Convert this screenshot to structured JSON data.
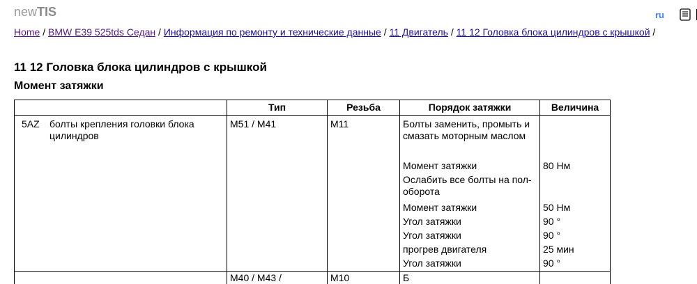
{
  "header": {
    "logo_prefix": "new",
    "logo_bold": "TIS",
    "lang": "ru"
  },
  "breadcrumb": {
    "items": [
      "Home",
      "BMW E39 525tds Седан",
      "Информация по ремонту и технические данные",
      "11 Двигатель",
      "11 12 Головка блока цилиндров с крышкой"
    ],
    "separator": " / "
  },
  "page": {
    "title": "11 12 Головка блока цилиндров с крышкой",
    "section": "Момент затяжки"
  },
  "table": {
    "headers": [
      "",
      "Тип",
      "Резьба",
      "Порядок затяжки",
      "Величина"
    ],
    "row": {
      "code": "5AZ",
      "description": "болты крепления головки блока цилиндров",
      "type": "M51 / M41",
      "thread": "M11",
      "steps": [
        {
          "step": "Болты заменить, промыть и смазать моторным маслом",
          "value": ""
        },
        {
          "step": "Момент затяжки",
          "value": "80 Нм"
        },
        {
          "step": "Ослабить все болты на пол-оборота",
          "value": ""
        },
        {
          "step": "Момент затяжки",
          "value": "50 Нм"
        },
        {
          "step": "Угол затяжки",
          "value": "90 °"
        },
        {
          "step": "Угол затяжки",
          "value": "90 °"
        },
        {
          "step": "прогрев двигателя",
          "value": "25 мин"
        },
        {
          "step": "Угол затяжки",
          "value": "90 °"
        }
      ]
    },
    "next_row_partial": {
      "type": "M40 / M43 /",
      "thread": "M10",
      "step": "Б"
    }
  }
}
